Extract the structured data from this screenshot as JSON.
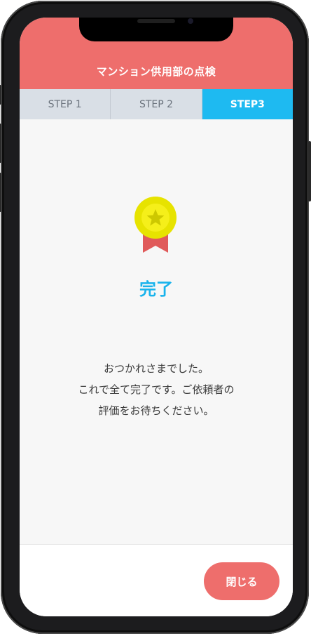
{
  "header": {
    "title": "マンション供用部の点検"
  },
  "steps": [
    {
      "label": "STEP 1"
    },
    {
      "label": "STEP 2"
    },
    {
      "label": "STEP3",
      "active": true
    }
  ],
  "main": {
    "icon": "medal-star-icon",
    "heading": "完了",
    "message_lines": [
      "おつかれさまでした。",
      "これで全て完了です。ご依頼者の",
      "評価をお待ちください。"
    ]
  },
  "footer": {
    "close_label": "閉じる"
  },
  "colors": {
    "header": "#ee6e6c",
    "active_step": "#1ebaf1",
    "inactive_step": "#d9dfe6",
    "heading": "#19b3ec",
    "medal_gold": "#f2ec00",
    "ribbon": "#e05a5a"
  }
}
